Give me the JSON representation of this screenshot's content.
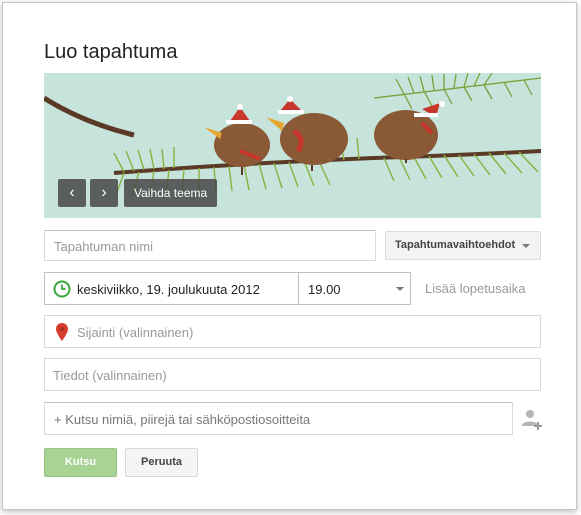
{
  "dialog": {
    "title": "Luo tapahtuma"
  },
  "banner": {
    "prev_icon": "chevron-left-icon",
    "next_icon": "chevron-right-icon",
    "prev_glyph": "‹",
    "next_glyph": "›",
    "theme_label": "Vaihda teema"
  },
  "form": {
    "event_name_placeholder": "Tapahtuman nimi",
    "options_label": "Tapahtumavaihtoehdot",
    "date_value": "keskiviikko, 19. joulukuuta 2012",
    "time_value": "19.00",
    "add_end_time": "Lisää lopetusaika",
    "location_placeholder": "Sijainti (valinnainen)",
    "details_placeholder": "Tiedot (valinnainen)",
    "invite_placeholder": "+ Kutsu nimiä, piirejä tai sähköpostiosoitteita"
  },
  "buttons": {
    "invite": "Kutsu",
    "cancel": "Peruuta"
  },
  "colors": {
    "accent_green": "#a8d395",
    "clock_green": "#3aa53a",
    "pin_red": "#d63d2e",
    "banner_bg": "#c6e3dc"
  }
}
